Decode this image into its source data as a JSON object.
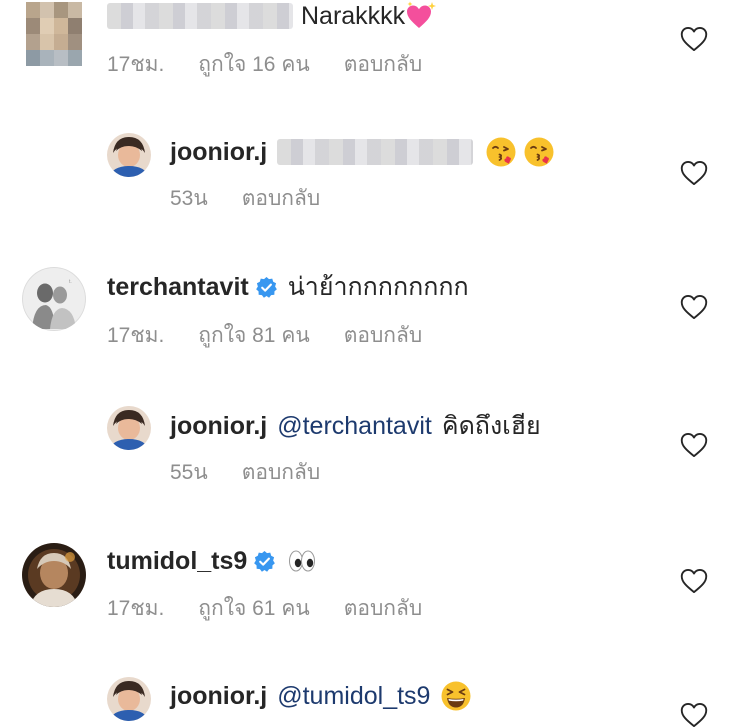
{
  "comments": [
    {
      "username": "",
      "text": "Narakkkk",
      "emoji": "sparkling-heart",
      "time": "17ชม.",
      "likes": "ถูกใจ 16 คน",
      "reply": "ตอบกลับ"
    },
    {
      "username": "joonior.j",
      "emoji": "kissing-face",
      "time": "53น",
      "reply": "ตอบกลับ"
    },
    {
      "username": "terchantavit",
      "verified": true,
      "text": "น่าย้ากกกกกกกก",
      "time": "17ชม.",
      "likes": "ถูกใจ 81 คน",
      "reply": "ตอบกลับ"
    },
    {
      "username": "joonior.j",
      "mention": "@terchantavit",
      "text": "คิดถึงเฮีย",
      "time": "55น",
      "reply": "ตอบกลับ"
    },
    {
      "username": "tumidol_ts9",
      "verified": true,
      "emoji": "eyes",
      "time": "17ชม.",
      "likes": "ถูกใจ 61 คน",
      "reply": "ตอบกลับ"
    },
    {
      "username": "joonior.j",
      "mention": "@tumidol_ts9",
      "emoji": "grinning-squinting-face"
    }
  ],
  "colors": {
    "text": "#262626",
    "meta": "#8e8e8e",
    "mention": "#1d3a6e",
    "verified": "#3897f0"
  }
}
